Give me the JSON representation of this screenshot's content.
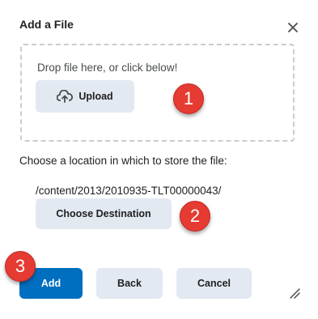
{
  "dialog": {
    "title": "Add a File",
    "close_icon": "close-icon",
    "dropzone": {
      "text": "Drop file here, or click below!",
      "upload_label": "Upload",
      "upload_icon": "cloud-upload-icon"
    },
    "location_label": "Choose a location in which to store the file:",
    "path": "/content/2013/2010935-TLT00000043/",
    "choose_destination_label": "Choose Destination",
    "buttons": {
      "add": "Add",
      "back": "Back",
      "cancel": "Cancel"
    },
    "resize_icon": "resize-handle-icon"
  },
  "annotations": {
    "badge1": "1",
    "badge2": "2",
    "badge3": "3"
  },
  "colors": {
    "primary": "#006fbf",
    "secondary_button": "#e3e9f1",
    "badge": "#e53b32",
    "dropzone_border": "#c9cdd3"
  }
}
